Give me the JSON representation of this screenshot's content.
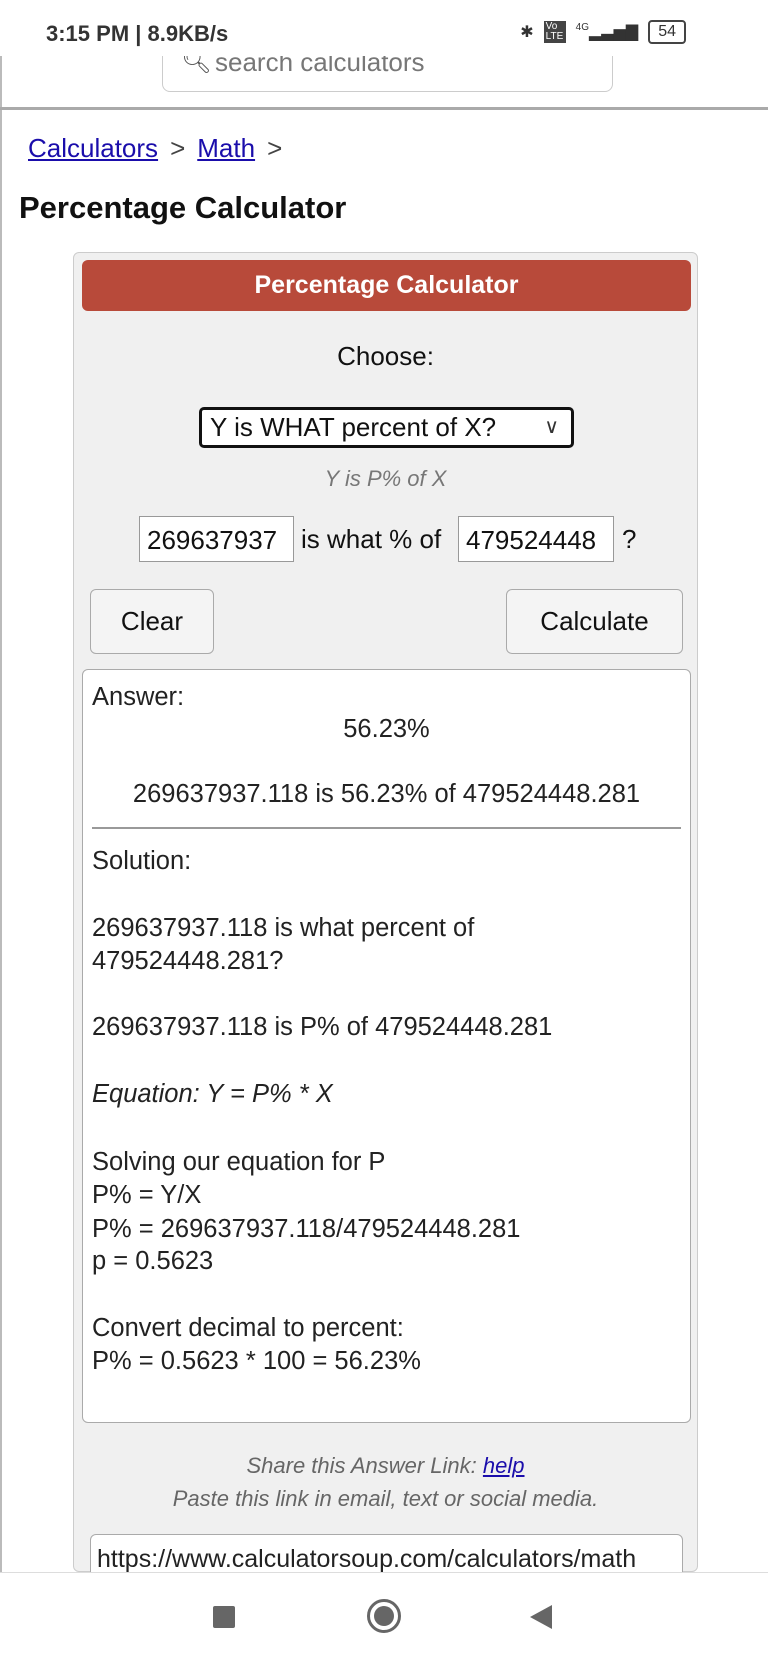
{
  "status_bar": {
    "time": "3:15 PM | 8.9KB/s",
    "battery": "54",
    "network": "4G",
    "volte": "Vo LTE"
  },
  "search": {
    "placeholder": "search calculators"
  },
  "breadcrumb": {
    "items": [
      "Calculators",
      "Math"
    ],
    "separator": ">"
  },
  "page_title": "Percentage Calculator",
  "calculator": {
    "header": "Percentage Calculator",
    "choose_label": "Choose:",
    "mode_selected": "Y is WHAT percent of X?",
    "hint": "Y is P% of X",
    "y_value": "269637937",
    "middle_text": "is what % of",
    "x_value": "479524448",
    "question_mark": "?",
    "clear_label": "Clear",
    "calculate_label": "Calculate"
  },
  "answer": {
    "label": "Answer:",
    "value": "56.23%",
    "statement": "269637937.118 is 56.23% of 479524448.281",
    "solution_label": "Solution:",
    "lines": [
      "269637937.118 is what percent of",
      "479524448.281?",
      "269637937.118 is P% of 479524448.281",
      "Equation: Y = P% * X",
      "Solving our equation for P",
      "P% = Y/X",
      "P% = 269637937.118/479524448.281",
      "p = 0.5623",
      "Convert decimal to percent:",
      "P% = 0.5623 * 100 = 56.23%"
    ]
  },
  "share": {
    "text": "Share this Answer Link:",
    "help_link": "help",
    "subtext": "Paste this link in email, text or social media.",
    "url": "https://www.calculatorsoup.com/calculators/math"
  },
  "colors": {
    "header": "#b84a3a",
    "link": "#1a0dab"
  }
}
